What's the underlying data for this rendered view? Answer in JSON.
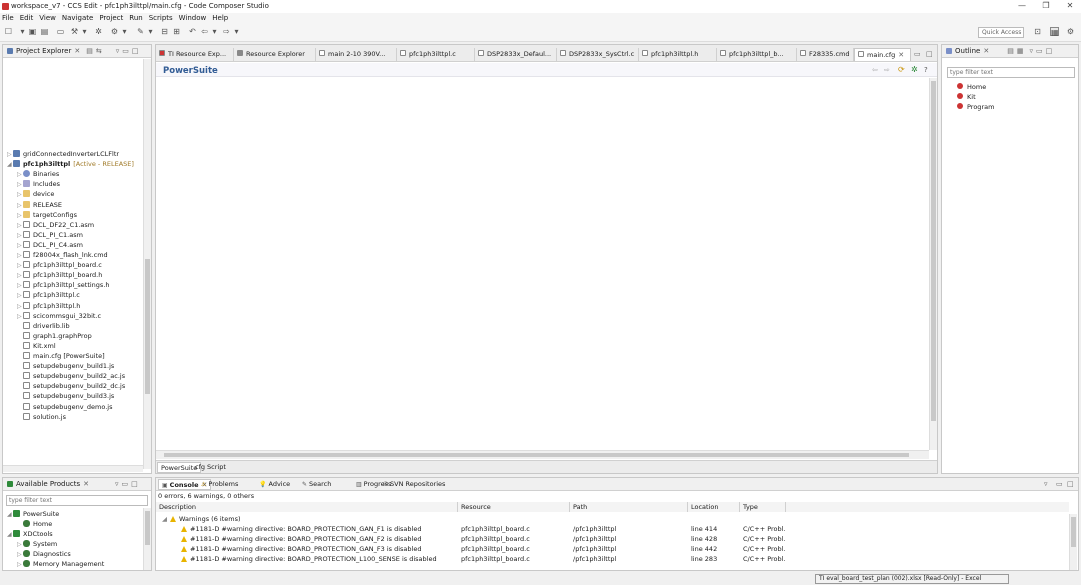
{
  "window": {
    "title": "workspace_v7 - CCS Edit - pfc1ph3ilttpl/main.cfg - Code Composer Studio"
  },
  "menu": [
    "File",
    "Edit",
    "View",
    "Navigate",
    "Project",
    "Run",
    "Scripts",
    "Window",
    "Help"
  ],
  "toolbar": {
    "quick_access": "Quick Access"
  },
  "project_explorer": {
    "title": "Project Explorer",
    "items": [
      {
        "label": "gridConnectedInverterLCLFltr",
        "depth": 0,
        "kind": "proj",
        "twisty": "▷"
      },
      {
        "label": "pfc1ph3ilttpl",
        "status": "[Active - RELEASE]",
        "depth": 0,
        "kind": "proj",
        "twisty": "◢"
      },
      {
        "label": "Binaries",
        "depth": 1,
        "kind": "bin",
        "twisty": "▷"
      },
      {
        "label": "Includes",
        "depth": 1,
        "kind": "inc",
        "twisty": "▷"
      },
      {
        "label": "device",
        "depth": 1,
        "kind": "folder",
        "twisty": "▷"
      },
      {
        "label": "RELEASE",
        "depth": 1,
        "kind": "folder",
        "twisty": "▷"
      },
      {
        "label": "targetConfigs",
        "depth": 1,
        "kind": "folder",
        "twisty": "▷"
      },
      {
        "label": "DCL_DF22_C1.asm",
        "depth": 1,
        "kind": "file",
        "twisty": "▷"
      },
      {
        "label": "DCL_PI_C1.asm",
        "depth": 1,
        "kind": "file",
        "twisty": "▷"
      },
      {
        "label": "DCL_PI_C4.asm",
        "depth": 1,
        "kind": "file",
        "twisty": "▷"
      },
      {
        "label": "f28004x_flash_lnk.cmd",
        "depth": 1,
        "kind": "file",
        "twisty": "▷"
      },
      {
        "label": "pfc1ph3ilttpl_board.c",
        "depth": 1,
        "kind": "file",
        "twisty": "▷"
      },
      {
        "label": "pfc1ph3ilttpl_board.h",
        "depth": 1,
        "kind": "file",
        "twisty": "▷"
      },
      {
        "label": "pfc1ph3ilttpl_settings.h",
        "depth": 1,
        "kind": "file",
        "twisty": "▷"
      },
      {
        "label": "pfc1ph3ilttpl.c",
        "depth": 1,
        "kind": "file",
        "twisty": "▷"
      },
      {
        "label": "pfc1ph3ilttpl.h",
        "depth": 1,
        "kind": "file",
        "twisty": "▷"
      },
      {
        "label": "scicommsgui_32bit.c",
        "depth": 1,
        "kind": "file",
        "twisty": "▷"
      },
      {
        "label": "driverlib.lib",
        "depth": 1,
        "kind": "file",
        "twisty": ""
      },
      {
        "label": "graph1.graphProp",
        "depth": 1,
        "kind": "file",
        "twisty": ""
      },
      {
        "label": "Kit.xml",
        "depth": 1,
        "kind": "file",
        "twisty": ""
      },
      {
        "label": "main.cfg [PowerSuite]",
        "depth": 1,
        "kind": "file",
        "twisty": ""
      },
      {
        "label": "setupdebugenv_build1.js",
        "depth": 1,
        "kind": "file",
        "twisty": ""
      },
      {
        "label": "setupdebugenv_build2_ac.js",
        "depth": 1,
        "kind": "file",
        "twisty": ""
      },
      {
        "label": "setupdebugenv_build2_dc.js",
        "depth": 1,
        "kind": "file",
        "twisty": ""
      },
      {
        "label": "setupdebugenv_build3.js",
        "depth": 1,
        "kind": "file",
        "twisty": ""
      },
      {
        "label": "setupdebugenv_demo.js",
        "depth": 1,
        "kind": "file",
        "twisty": ""
      },
      {
        "label": "solution.js",
        "depth": 1,
        "kind": "file",
        "twisty": ""
      }
    ]
  },
  "editor": {
    "tabs": [
      "TI Resource Exp...",
      "Resource Explorer",
      "main 2-10 390V...",
      "pfc1ph3ilttpl.c",
      "DSP2833x_Defaul...",
      "DSP2833x_SysCtrl.c",
      "pfc1ph3ilttpl.h",
      "pfc1ph3ilttpl_b...",
      "F28335.cmd",
      "main.cfg"
    ],
    "active_tab": "main.cfg",
    "heading": "PowerSuite",
    "bottom_tabs": [
      "PowerSuite",
      "cfg Script"
    ]
  },
  "outline": {
    "title": "Outline",
    "filter_placeholder": "type filter text",
    "items": [
      "Home",
      "Kit",
      "Program"
    ]
  },
  "available_products": {
    "title": "Available Products",
    "filter_placeholder": "type filter text",
    "items": [
      {
        "label": "PowerSuite",
        "depth": 0,
        "twisty": "◢"
      },
      {
        "label": "Home",
        "depth": 1,
        "twisty": ""
      },
      {
        "label": "XDCtools",
        "depth": 0,
        "twisty": "◢"
      },
      {
        "label": "System",
        "depth": 1,
        "twisty": "▷"
      },
      {
        "label": "Diagnostics",
        "depth": 1,
        "twisty": "▷"
      },
      {
        "label": "Memory Management",
        "depth": 1,
        "twisty": "▷"
      }
    ]
  },
  "problems": {
    "tabs": [
      "Console",
      "Problems",
      "Advice",
      "Search",
      "Progress",
      "SVN Repositories"
    ],
    "summary": "0 errors, 6 warnings, 0 others",
    "columns": [
      "Description",
      "Resource",
      "Path",
      "Location",
      "Type"
    ],
    "group": "Warnings (6 items)",
    "rows": [
      {
        "description": "#1181-D #warning directive: BOARD_PROTECTION_GAN_F1 is disabled",
        "resource": "pfc1ph3ilttpl_board.c",
        "path": "/pfc1ph3ilttpl",
        "location": "line 414",
        "type": "C/C++ Probl..."
      },
      {
        "description": "#1181-D #warning directive: BOARD_PROTECTION_GAN_F2 is disabled",
        "resource": "pfc1ph3ilttpl_board.c",
        "path": "/pfc1ph3ilttpl",
        "location": "line 428",
        "type": "C/C++ Probl..."
      },
      {
        "description": "#1181-D #warning directive: BOARD_PROTECTION_GAN_F3 is disabled",
        "resource": "pfc1ph3ilttpl_board.c",
        "path": "/pfc1ph3ilttpl",
        "location": "line 442",
        "type": "C/C++ Probl..."
      },
      {
        "description": "#1181-D #warning directive: BOARD_PROTECTION_L100_SENSE is disabled",
        "resource": "pfc1ph3ilttpl_board.c",
        "path": "/pfc1ph3ilttpl",
        "location": "line 283",
        "type": "C/C++ Probl..."
      }
    ]
  },
  "taskbar_tooltip": "TI eval_board_test_plan (002).xlsx [Read-Only] - Excel"
}
